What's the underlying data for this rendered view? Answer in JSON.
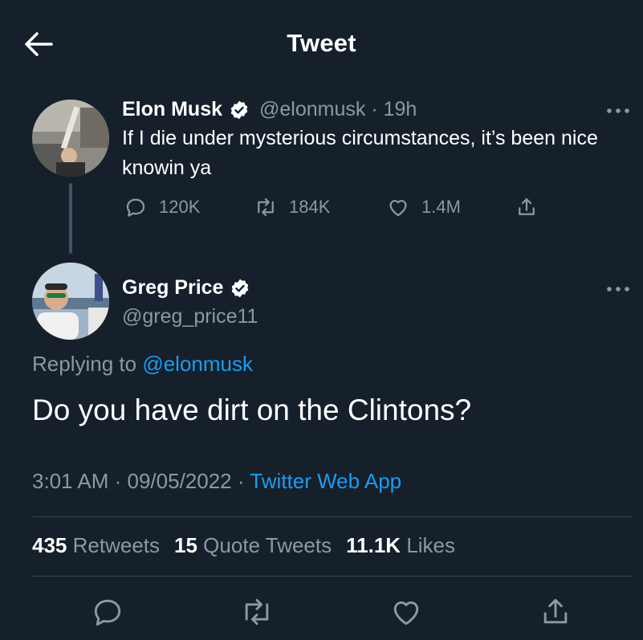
{
  "header": {
    "title": "Tweet"
  },
  "parent_tweet": {
    "name": "Elon Musk",
    "handle": "@elonmusk",
    "separator": " · ",
    "time": "19h",
    "text": "If I die under mysterious circumstances, it’s been nice knowin ya",
    "replies": "120K",
    "retweets": "184K",
    "likes": "1.4M"
  },
  "main_tweet": {
    "name": "Greg Price",
    "handle": "@greg_price11",
    "replying_prefix": "Replying to",
    "replying_to": "@elonmusk",
    "text": "Do you have dirt on the Clintons?",
    "time": "3:01 AM",
    "dot1": " · ",
    "date": "09/05/2022",
    "dot2": " · ",
    "source": "Twitter Web App"
  },
  "stats": {
    "retweets_count": "435",
    "retweets_label": "Retweets",
    "quotes_count": "15",
    "quotes_label": "Quote Tweets",
    "likes_count": "11.1K",
    "likes_label": "Likes"
  },
  "colors": {
    "background": "#15202b",
    "accent": "#1d9bf0",
    "muted": "#8b98a5",
    "divider": "#38444d"
  },
  "icons": [
    "back-arrow-icon",
    "verified-icon",
    "more-icon",
    "reply-icon",
    "retweet-icon",
    "like-icon",
    "share-icon"
  ]
}
